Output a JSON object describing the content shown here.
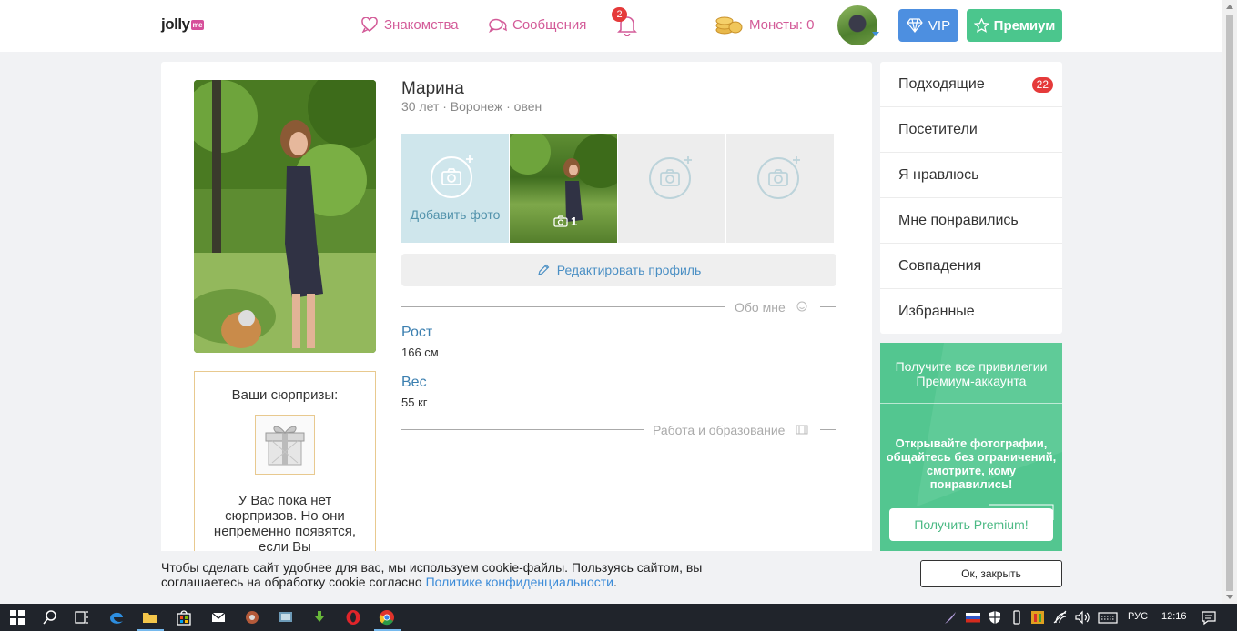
{
  "header": {
    "logo_text": "jolly",
    "logo_badge": "me",
    "nav": {
      "dating": "Знакомства",
      "messages": "Сообщения"
    },
    "notifications_count": "2",
    "coins_label": "Монеты: 0",
    "vip_label": "VIP",
    "premium_label": "Премиум"
  },
  "profile": {
    "name": "Марина",
    "subtitle": "30 лет · Воронеж · овен",
    "add_photo_label": "Добавить фото",
    "photo_count": "1",
    "edit_label": "Редактировать профиль",
    "section_about": "Обо мне",
    "fields": [
      {
        "label": "Рост",
        "value": "166 см"
      },
      {
        "label": "Вес",
        "value": "55 кг"
      }
    ],
    "section_work": "Работа и образование"
  },
  "gifts": {
    "title": "Ваши сюрпризы:",
    "text": "У Вас пока нет сюрпризов. Но они непременно появятся, если Вы"
  },
  "sidebar": {
    "items": [
      {
        "label": "Подходящие",
        "badge": "22"
      },
      {
        "label": "Посетители"
      },
      {
        "label": "Я нравлюсь"
      },
      {
        "label": "Мне понравились"
      },
      {
        "label": "Совпадения"
      },
      {
        "label": "Избранные"
      }
    ]
  },
  "promo": {
    "title": "Получите все привилегии Премиум-аккаунта",
    "text": "Открывайте фотографии, общайтесь без ограничений, смотрите, кому понравились!",
    "button": "Получить Premium!"
  },
  "cookie": {
    "text": "Чтобы сделать сайт удобнее для вас, мы используем cookie-файлы. Пользуясь сайтом, вы соглашаетесь на обработку cookie согласно ",
    "link": "Политике конфиденциальности",
    "suffix": ".",
    "button": "Ок, закрыть"
  },
  "taskbar": {
    "language": "РУС",
    "time": "12:16"
  },
  "colors": {
    "accent_pink": "#d35b98",
    "vip_blue": "#4d8fe0",
    "premium_green": "#4bc68d",
    "badge_red": "#e53a3a",
    "link_blue": "#3b8bd8"
  }
}
